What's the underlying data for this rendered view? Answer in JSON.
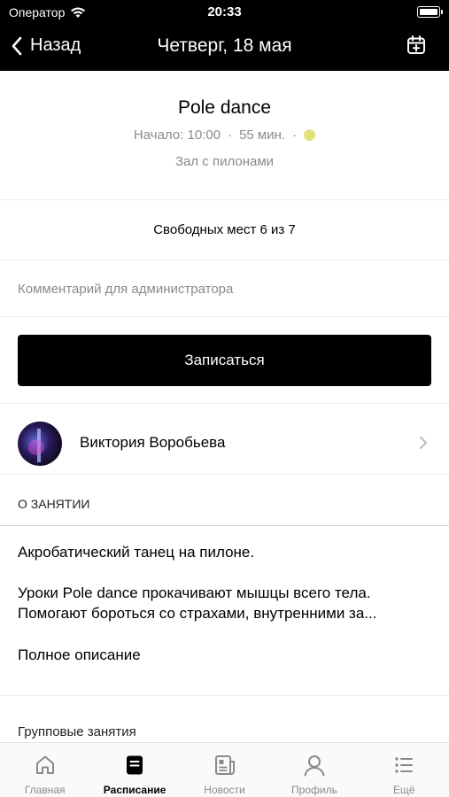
{
  "status_bar": {
    "carrier": "Оператор",
    "time": "20:33"
  },
  "nav": {
    "back_label": "Назад",
    "title": "Четверг, 18 мая"
  },
  "class": {
    "name": "Pole dance",
    "start": "Начало: 10:00",
    "duration": "55 мин.",
    "separator": "·",
    "room": "Зал с пилонами",
    "color": "#e2e27a"
  },
  "seats": "Свободных мест 6 из 7",
  "comment": {
    "placeholder": "Комментарий для администратора"
  },
  "signup_label": "Записаться",
  "trainer": {
    "name": "Виктория Воробьева"
  },
  "about": {
    "heading": "О ЗАНЯТИИ",
    "line1": "Акробатический танец на пилоне.",
    "description": "Уроки Pole dance прокачивают мышцы всего тела. Помогают бороться со страхами, внутренними за...",
    "more_label": "Полное описание"
  },
  "group_label": "Групповые занятия",
  "tabs": [
    {
      "label": "Главная",
      "icon": "home-icon"
    },
    {
      "label": "Расписание",
      "icon": "schedule-icon",
      "active": true
    },
    {
      "label": "Новости",
      "icon": "news-icon"
    },
    {
      "label": "Профиль",
      "icon": "profile-icon"
    },
    {
      "label": "Ещё",
      "icon": "more-icon"
    }
  ]
}
